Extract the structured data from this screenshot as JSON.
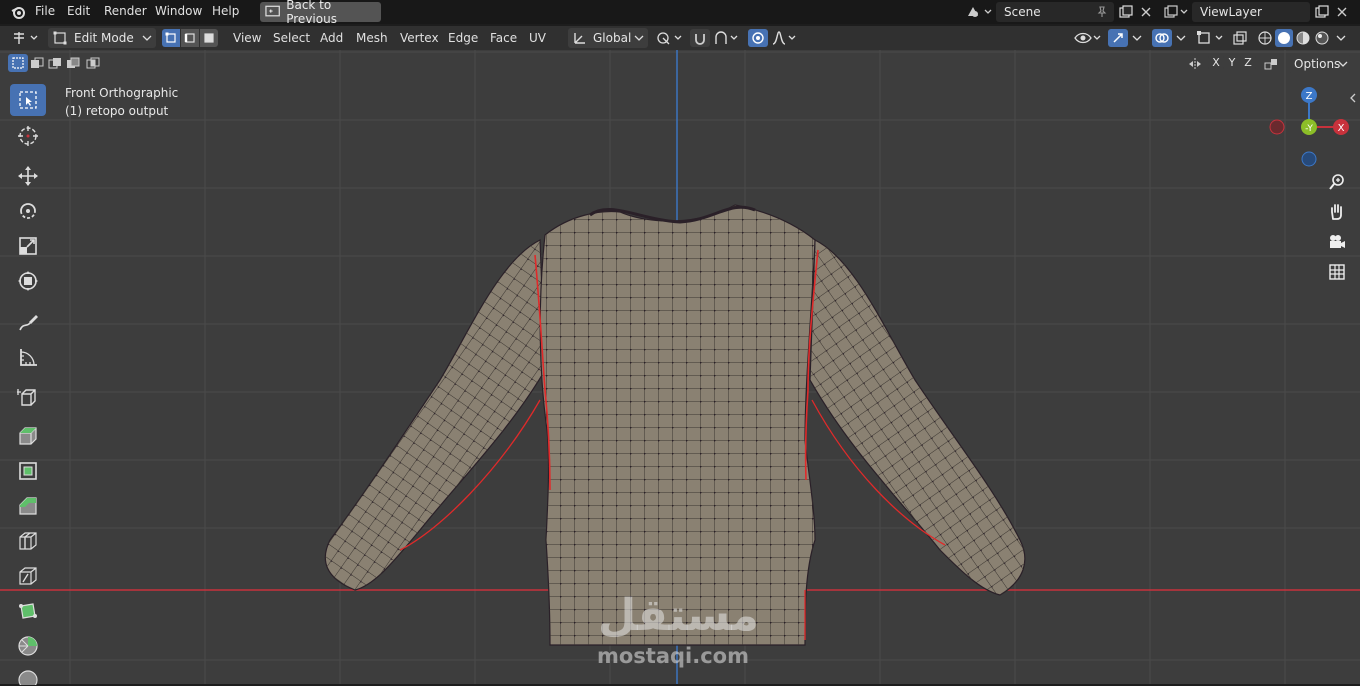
{
  "topbar": {
    "menus": [
      "File",
      "Edit",
      "Render",
      "Window",
      "Help"
    ],
    "back_button": "Back to Previous",
    "scene_field": "Scene",
    "viewlayer_field": "ViewLayer"
  },
  "header": {
    "mode": "Edit Mode",
    "menus": [
      "View",
      "Select",
      "Add",
      "Mesh",
      "Vertex",
      "Edge",
      "Face",
      "UV"
    ],
    "orientation": "Global"
  },
  "viewport": {
    "view_name": "Front Orthographic",
    "object_name": "(1) retopo output",
    "options_label": "Options",
    "axis_labels": [
      "X",
      "Y",
      "Z"
    ],
    "gizmo": {
      "z": "Z",
      "y": "-Y",
      "x": "X"
    }
  },
  "watermark": {
    "arabic": "مستقل",
    "latin": "mostaqi.com"
  },
  "colors": {
    "accent": "#4772b3",
    "x_axis": "#c8323c",
    "z_axis": "#3c78c8",
    "y_gizmo": "#8cbe28",
    "mesh": "#8a8172"
  },
  "icons": {
    "tools": [
      "select-box-icon",
      "cursor-icon",
      "move-icon",
      "rotate-icon",
      "scale-icon",
      "transform-icon",
      "annotate-icon",
      "measure-icon",
      "add-cube-icon",
      "extrude-icon",
      "inset-icon",
      "bevel-icon",
      "loop-cut-icon",
      "knife-icon",
      "poly-build-icon",
      "spin-icon",
      "smooth-icon"
    ],
    "nav": [
      "zoom-icon",
      "hand-icon",
      "camera-icon",
      "grid-icon"
    ]
  }
}
